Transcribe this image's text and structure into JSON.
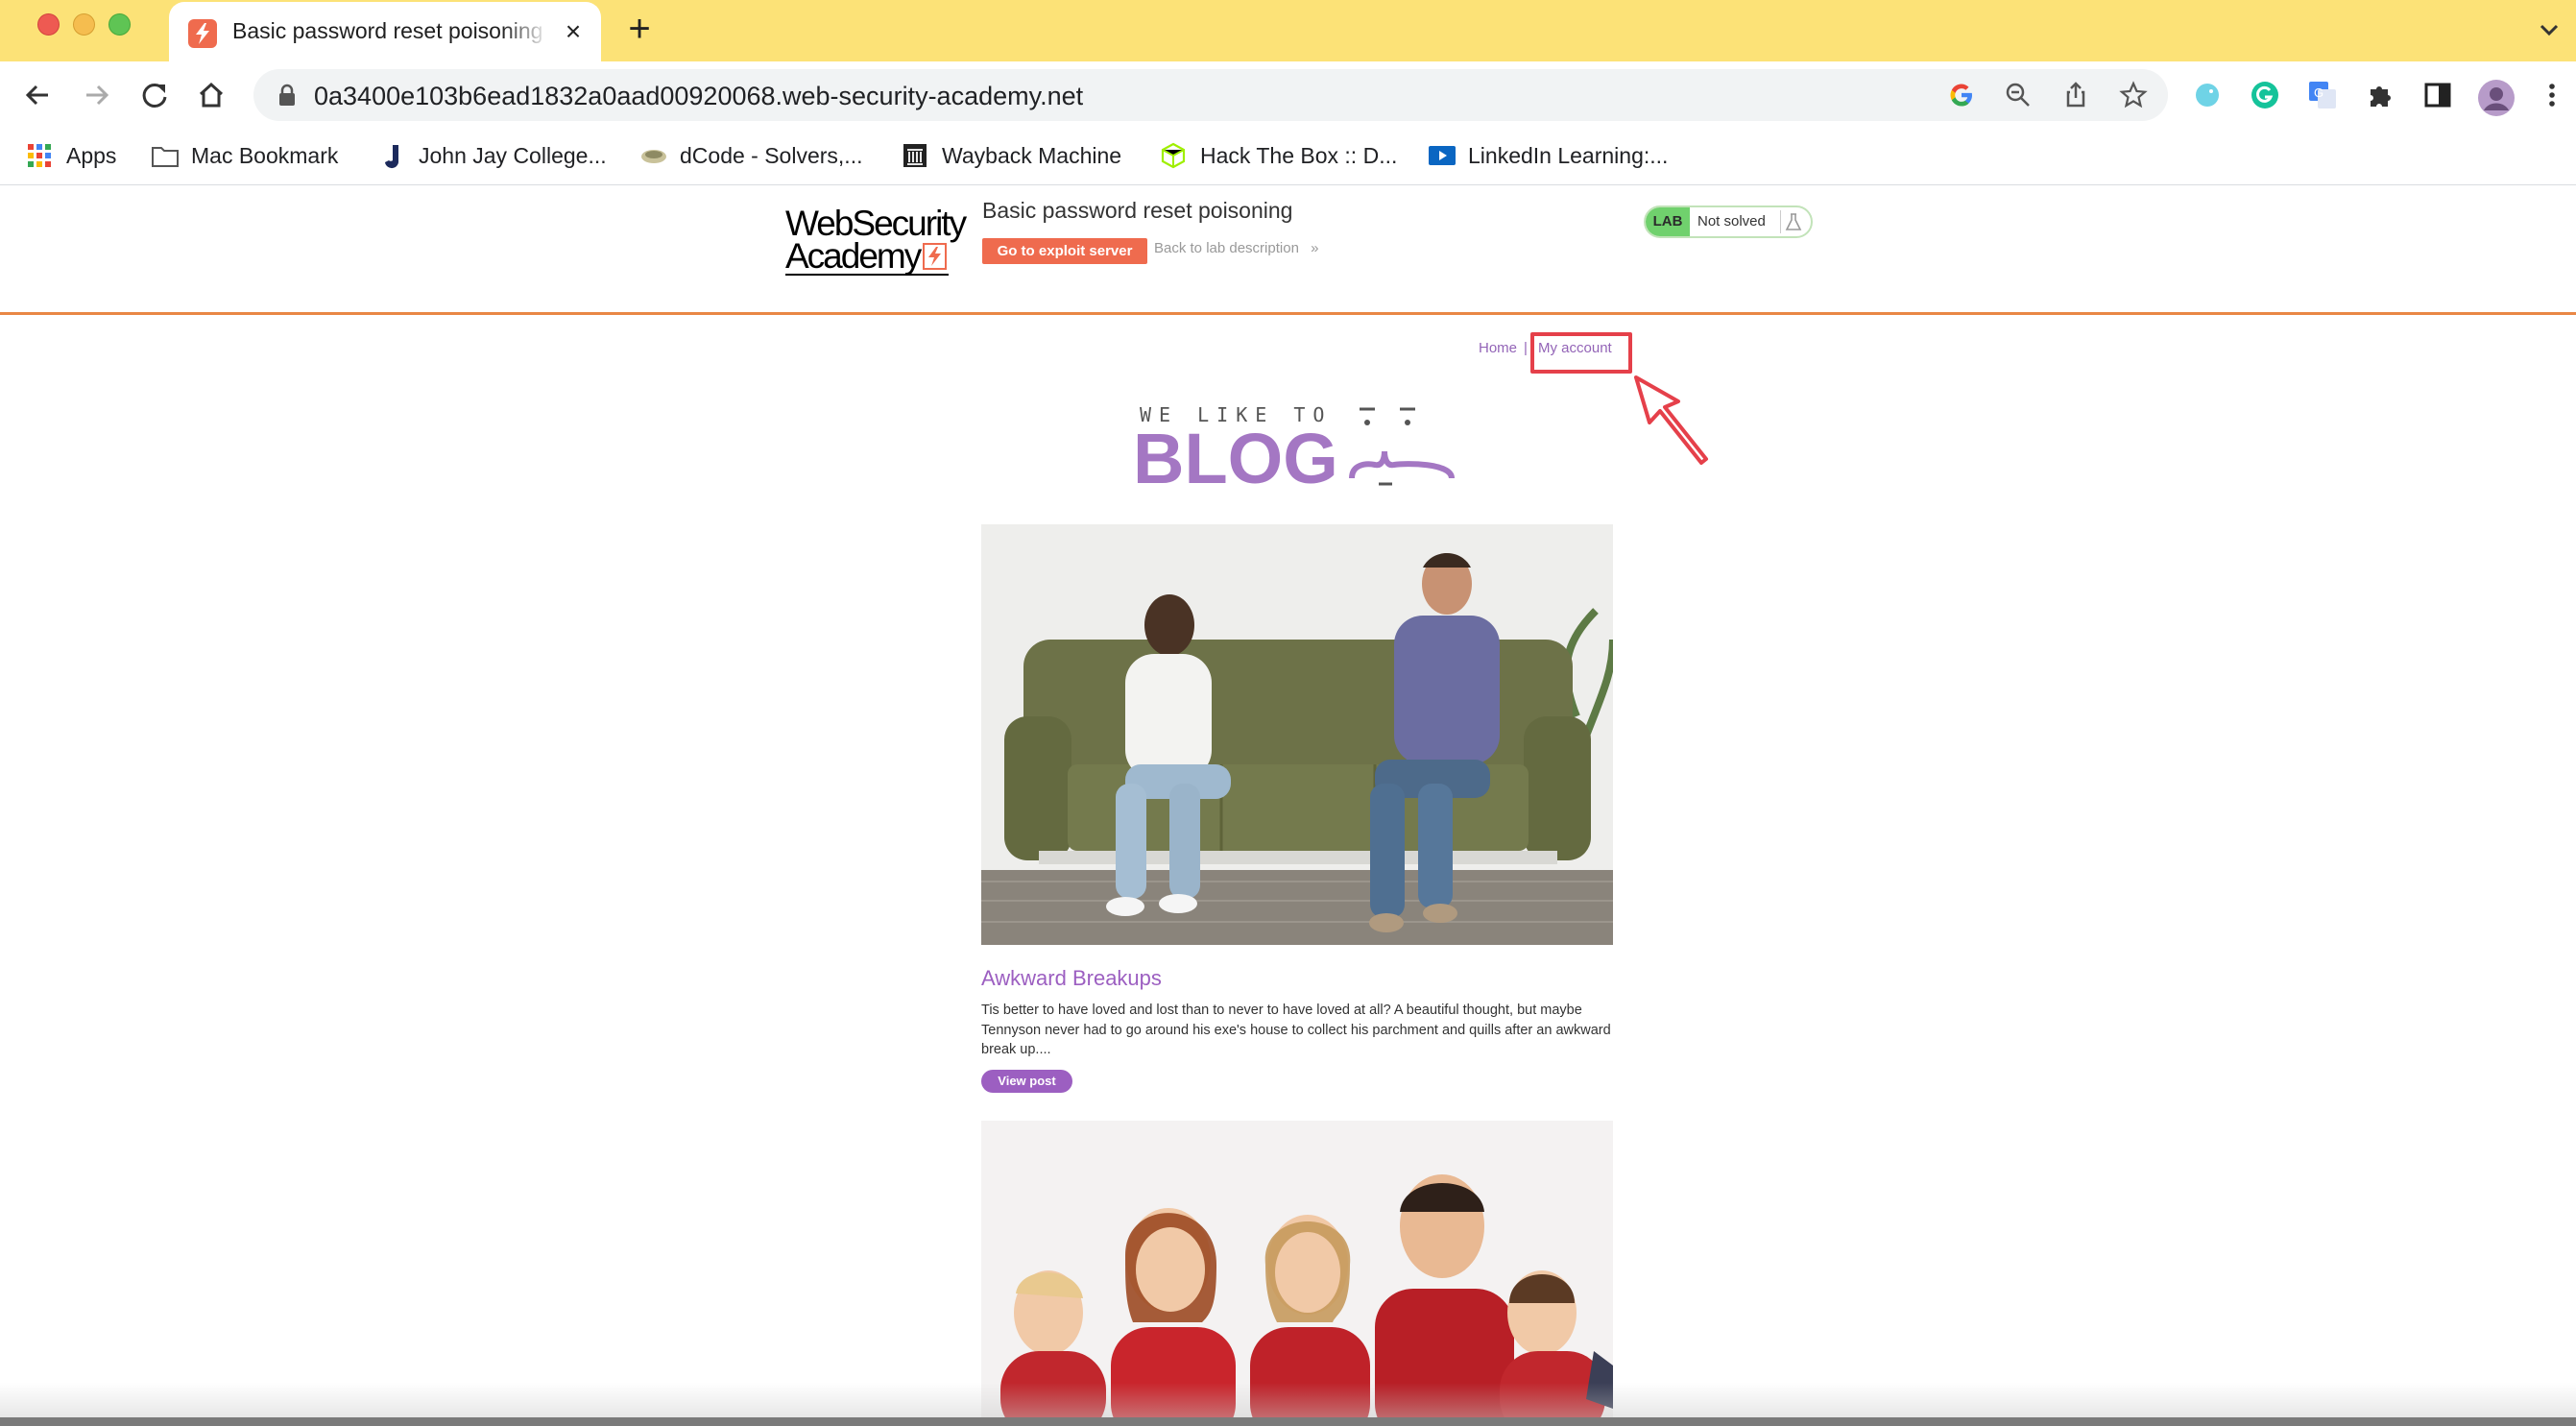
{
  "browser": {
    "tab": {
      "title": "Basic password reset poisoning",
      "close_glyph": "×"
    },
    "new_tab_glyph": "+",
    "url": "0a3400e103b6ead1832a0aad00920068.web-security-academy.net",
    "bookmarks": [
      {
        "label": "Apps",
        "icon": "apps-grid-icon"
      },
      {
        "label": "Mac Bookmark",
        "icon": "folder-icon"
      },
      {
        "label": "John Jay College...",
        "icon": "john-jay-icon"
      },
      {
        "label": "dCode - Solvers,...",
        "icon": "dcode-icon"
      },
      {
        "label": "Wayback Machine",
        "icon": "wayback-icon"
      },
      {
        "label": "Hack The Box :: D...",
        "icon": "htb-icon"
      },
      {
        "label": "LinkedIn Learning:...",
        "icon": "linkedin-learning-icon"
      }
    ]
  },
  "lab": {
    "logo_line1": "WebSecurity",
    "logo_line2": "Academy",
    "title": "Basic password reset poisoning",
    "exploit_button": "Go to exploit server",
    "back_link": "Back to lab description",
    "back_link_glyph": "»",
    "badge": "LAB",
    "status": "Not solved",
    "accent_color": "#ef6b4e",
    "status_color": "#70d16d"
  },
  "nav": {
    "home": "Home",
    "separator": "|",
    "my_account": "My account",
    "link_color": "#9364b7",
    "annotation_color": "#e5404a"
  },
  "blog_header": {
    "small_text": "WE LIKE TO",
    "big_text": "BLOG"
  },
  "posts": [
    {
      "title": "Awkward Breakups",
      "summary": "Tis better to have loved and lost than to never to have loved at all? A beautiful thought, but maybe Tennyson never had to go around his exe's house to collect his parchment and quills after an awkward break up....",
      "button": "View post"
    }
  ]
}
